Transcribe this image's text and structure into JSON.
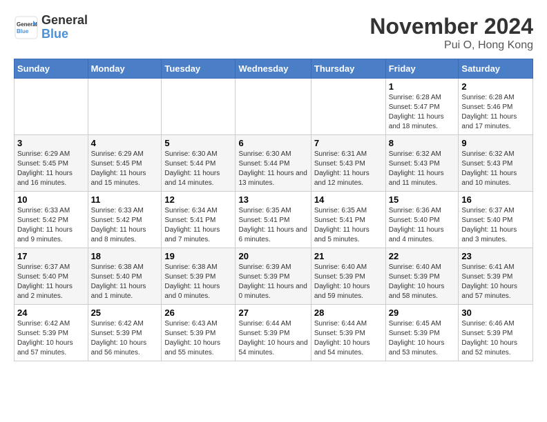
{
  "header": {
    "logo_general": "General",
    "logo_blue": "Blue",
    "month_title": "November 2024",
    "location": "Pui O, Hong Kong"
  },
  "days_of_week": [
    "Sunday",
    "Monday",
    "Tuesday",
    "Wednesday",
    "Thursday",
    "Friday",
    "Saturday"
  ],
  "weeks": [
    [
      {
        "day": "",
        "info": ""
      },
      {
        "day": "",
        "info": ""
      },
      {
        "day": "",
        "info": ""
      },
      {
        "day": "",
        "info": ""
      },
      {
        "day": "",
        "info": ""
      },
      {
        "day": "1",
        "info": "Sunrise: 6:28 AM\nSunset: 5:47 PM\nDaylight: 11 hours and 18 minutes."
      },
      {
        "day": "2",
        "info": "Sunrise: 6:28 AM\nSunset: 5:46 PM\nDaylight: 11 hours and 17 minutes."
      }
    ],
    [
      {
        "day": "3",
        "info": "Sunrise: 6:29 AM\nSunset: 5:45 PM\nDaylight: 11 hours and 16 minutes."
      },
      {
        "day": "4",
        "info": "Sunrise: 6:29 AM\nSunset: 5:45 PM\nDaylight: 11 hours and 15 minutes."
      },
      {
        "day": "5",
        "info": "Sunrise: 6:30 AM\nSunset: 5:44 PM\nDaylight: 11 hours and 14 minutes."
      },
      {
        "day": "6",
        "info": "Sunrise: 6:30 AM\nSunset: 5:44 PM\nDaylight: 11 hours and 13 minutes."
      },
      {
        "day": "7",
        "info": "Sunrise: 6:31 AM\nSunset: 5:43 PM\nDaylight: 11 hours and 12 minutes."
      },
      {
        "day": "8",
        "info": "Sunrise: 6:32 AM\nSunset: 5:43 PM\nDaylight: 11 hours and 11 minutes."
      },
      {
        "day": "9",
        "info": "Sunrise: 6:32 AM\nSunset: 5:43 PM\nDaylight: 11 hours and 10 minutes."
      }
    ],
    [
      {
        "day": "10",
        "info": "Sunrise: 6:33 AM\nSunset: 5:42 PM\nDaylight: 11 hours and 9 minutes."
      },
      {
        "day": "11",
        "info": "Sunrise: 6:33 AM\nSunset: 5:42 PM\nDaylight: 11 hours and 8 minutes."
      },
      {
        "day": "12",
        "info": "Sunrise: 6:34 AM\nSunset: 5:41 PM\nDaylight: 11 hours and 7 minutes."
      },
      {
        "day": "13",
        "info": "Sunrise: 6:35 AM\nSunset: 5:41 PM\nDaylight: 11 hours and 6 minutes."
      },
      {
        "day": "14",
        "info": "Sunrise: 6:35 AM\nSunset: 5:41 PM\nDaylight: 11 hours and 5 minutes."
      },
      {
        "day": "15",
        "info": "Sunrise: 6:36 AM\nSunset: 5:40 PM\nDaylight: 11 hours and 4 minutes."
      },
      {
        "day": "16",
        "info": "Sunrise: 6:37 AM\nSunset: 5:40 PM\nDaylight: 11 hours and 3 minutes."
      }
    ],
    [
      {
        "day": "17",
        "info": "Sunrise: 6:37 AM\nSunset: 5:40 PM\nDaylight: 11 hours and 2 minutes."
      },
      {
        "day": "18",
        "info": "Sunrise: 6:38 AM\nSunset: 5:40 PM\nDaylight: 11 hours and 1 minute."
      },
      {
        "day": "19",
        "info": "Sunrise: 6:38 AM\nSunset: 5:39 PM\nDaylight: 11 hours and 0 minutes."
      },
      {
        "day": "20",
        "info": "Sunrise: 6:39 AM\nSunset: 5:39 PM\nDaylight: 11 hours and 0 minutes."
      },
      {
        "day": "21",
        "info": "Sunrise: 6:40 AM\nSunset: 5:39 PM\nDaylight: 10 hours and 59 minutes."
      },
      {
        "day": "22",
        "info": "Sunrise: 6:40 AM\nSunset: 5:39 PM\nDaylight: 10 hours and 58 minutes."
      },
      {
        "day": "23",
        "info": "Sunrise: 6:41 AM\nSunset: 5:39 PM\nDaylight: 10 hours and 57 minutes."
      }
    ],
    [
      {
        "day": "24",
        "info": "Sunrise: 6:42 AM\nSunset: 5:39 PM\nDaylight: 10 hours and 57 minutes."
      },
      {
        "day": "25",
        "info": "Sunrise: 6:42 AM\nSunset: 5:39 PM\nDaylight: 10 hours and 56 minutes."
      },
      {
        "day": "26",
        "info": "Sunrise: 6:43 AM\nSunset: 5:39 PM\nDaylight: 10 hours and 55 minutes."
      },
      {
        "day": "27",
        "info": "Sunrise: 6:44 AM\nSunset: 5:39 PM\nDaylight: 10 hours and 54 minutes."
      },
      {
        "day": "28",
        "info": "Sunrise: 6:44 AM\nSunset: 5:39 PM\nDaylight: 10 hours and 54 minutes."
      },
      {
        "day": "29",
        "info": "Sunrise: 6:45 AM\nSunset: 5:39 PM\nDaylight: 10 hours and 53 minutes."
      },
      {
        "day": "30",
        "info": "Sunrise: 6:46 AM\nSunset: 5:39 PM\nDaylight: 10 hours and 52 minutes."
      }
    ]
  ]
}
